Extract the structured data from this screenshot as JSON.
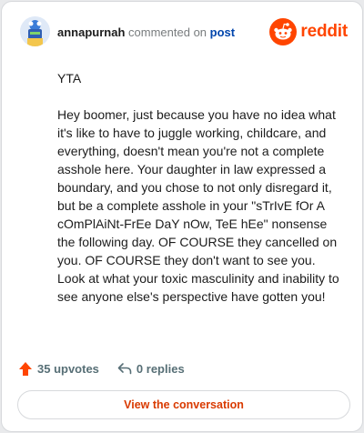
{
  "header": {
    "username": "annapurnah",
    "commented_text": "commented on",
    "post_link": "post",
    "brand": "reddit"
  },
  "comment": {
    "paragraphs": [
      "YTA",
      "Hey boomer, just because you have no idea what it's like to have to juggle working, childcare, and everything, doesn't mean you're not a complete asshole here. Your daughter in law expressed a boundary, and you chose to not only disregard it, but be a complete asshole in your \"sTrIvE fOr A cOmPlAiNt-FrEe DaY nOw, TeE hEe\" nonsense the following day. OF COURSE they cancelled on you. OF COURSE they don't want to see you. Look at what your toxic masculinity and inability to see anyone else's perspective have gotten you!"
    ]
  },
  "actions": {
    "upvotes": "35 upvotes",
    "replies": "0 replies"
  },
  "footer": {
    "view_button": "View the conversation"
  },
  "colors": {
    "brand": "#ff4500",
    "link": "#0045ac",
    "muted": "#576f76"
  }
}
